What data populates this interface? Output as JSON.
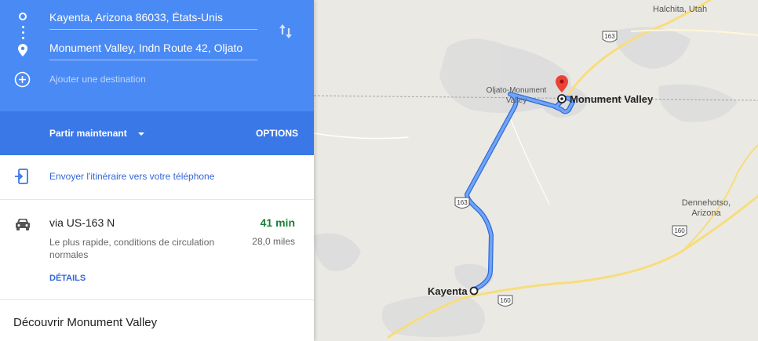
{
  "directions": {
    "origin": "Kayenta, Arizona 86033, États-Unis",
    "destination": "Monument Valley, Indn Route 42, Oljato",
    "add_destination": "Ajouter une destination",
    "depart_label": "Partir maintenant",
    "options_label": "OPTIONS",
    "send_to_phone": "Envoyer l'itinéraire vers votre téléphone"
  },
  "route": {
    "via": "via US-163 N",
    "duration": "41 min",
    "description": "Le plus rapide, conditions de circulation normales",
    "distance": "28,0 miles",
    "details_label": "DÉTAILS"
  },
  "discover": "Découvrir Monument Valley",
  "map": {
    "labels": {
      "halchita": "Halchita, Utah",
      "oljato_line1": "Oljato-Monument",
      "oljato_line2": "Valley",
      "destination": "Monument Valley",
      "origin": "Kayenta",
      "dennehotso_line1": "Dennehotso,",
      "dennehotso_line2": "Arizona"
    },
    "shields": {
      "us163_top": "163",
      "us163_mid": "163",
      "us160_right": "160",
      "us160_bottom": "160"
    },
    "colors": {
      "route": "#4a8af4",
      "pin": "#ea4335",
      "header": "#4a8af4",
      "duration": "#188038"
    }
  }
}
